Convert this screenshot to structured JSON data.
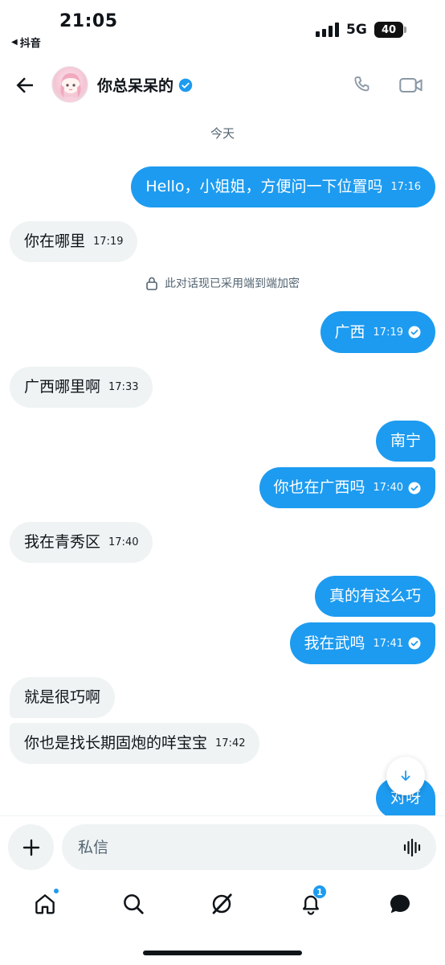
{
  "status_bar": {
    "time": "21:05",
    "back_app": "抖音",
    "network": "5G",
    "battery": "40"
  },
  "header": {
    "contact_name": "你总呆呆的"
  },
  "date_separator": "今天",
  "encryption_notice": "此对话现已采用端到端加密",
  "messages": [
    {
      "dir": "out",
      "text": "Hello，小姐姐，方便问一下位置吗",
      "time": "17:16",
      "read": false
    },
    {
      "dir": "in",
      "text": "你在哪里",
      "time": "17:19"
    },
    {
      "dir": "out",
      "text": "广西",
      "time": "17:19",
      "read": true
    },
    {
      "dir": "in",
      "text": "广西哪里啊",
      "time": "17:33"
    },
    {
      "dir": "out",
      "text": "南宁",
      "time": "",
      "read": false
    },
    {
      "dir": "out",
      "text": "你也在广西吗",
      "time": "17:40",
      "read": true
    },
    {
      "dir": "in",
      "text": "我在青秀区",
      "time": "17:40"
    },
    {
      "dir": "out",
      "text": "真的有这么巧",
      "time": "",
      "read": false
    },
    {
      "dir": "out",
      "text": "我在武鸣",
      "time": "17:41",
      "read": true
    },
    {
      "dir": "in",
      "text": "就是很巧啊",
      "time": ""
    },
    {
      "dir": "in",
      "text": "你也是找长期固炮的咩宝宝",
      "time": "17:42"
    },
    {
      "dir": "out",
      "text": "对呀",
      "time": "",
      "read": false
    }
  ],
  "composer": {
    "placeholder": "私信"
  },
  "tabbar": {
    "notification_count": "1"
  },
  "colors": {
    "accent": "#1d9bf0",
    "incoming_bubble": "#eff3f4",
    "text": "#0f1419",
    "muted": "#536471"
  }
}
